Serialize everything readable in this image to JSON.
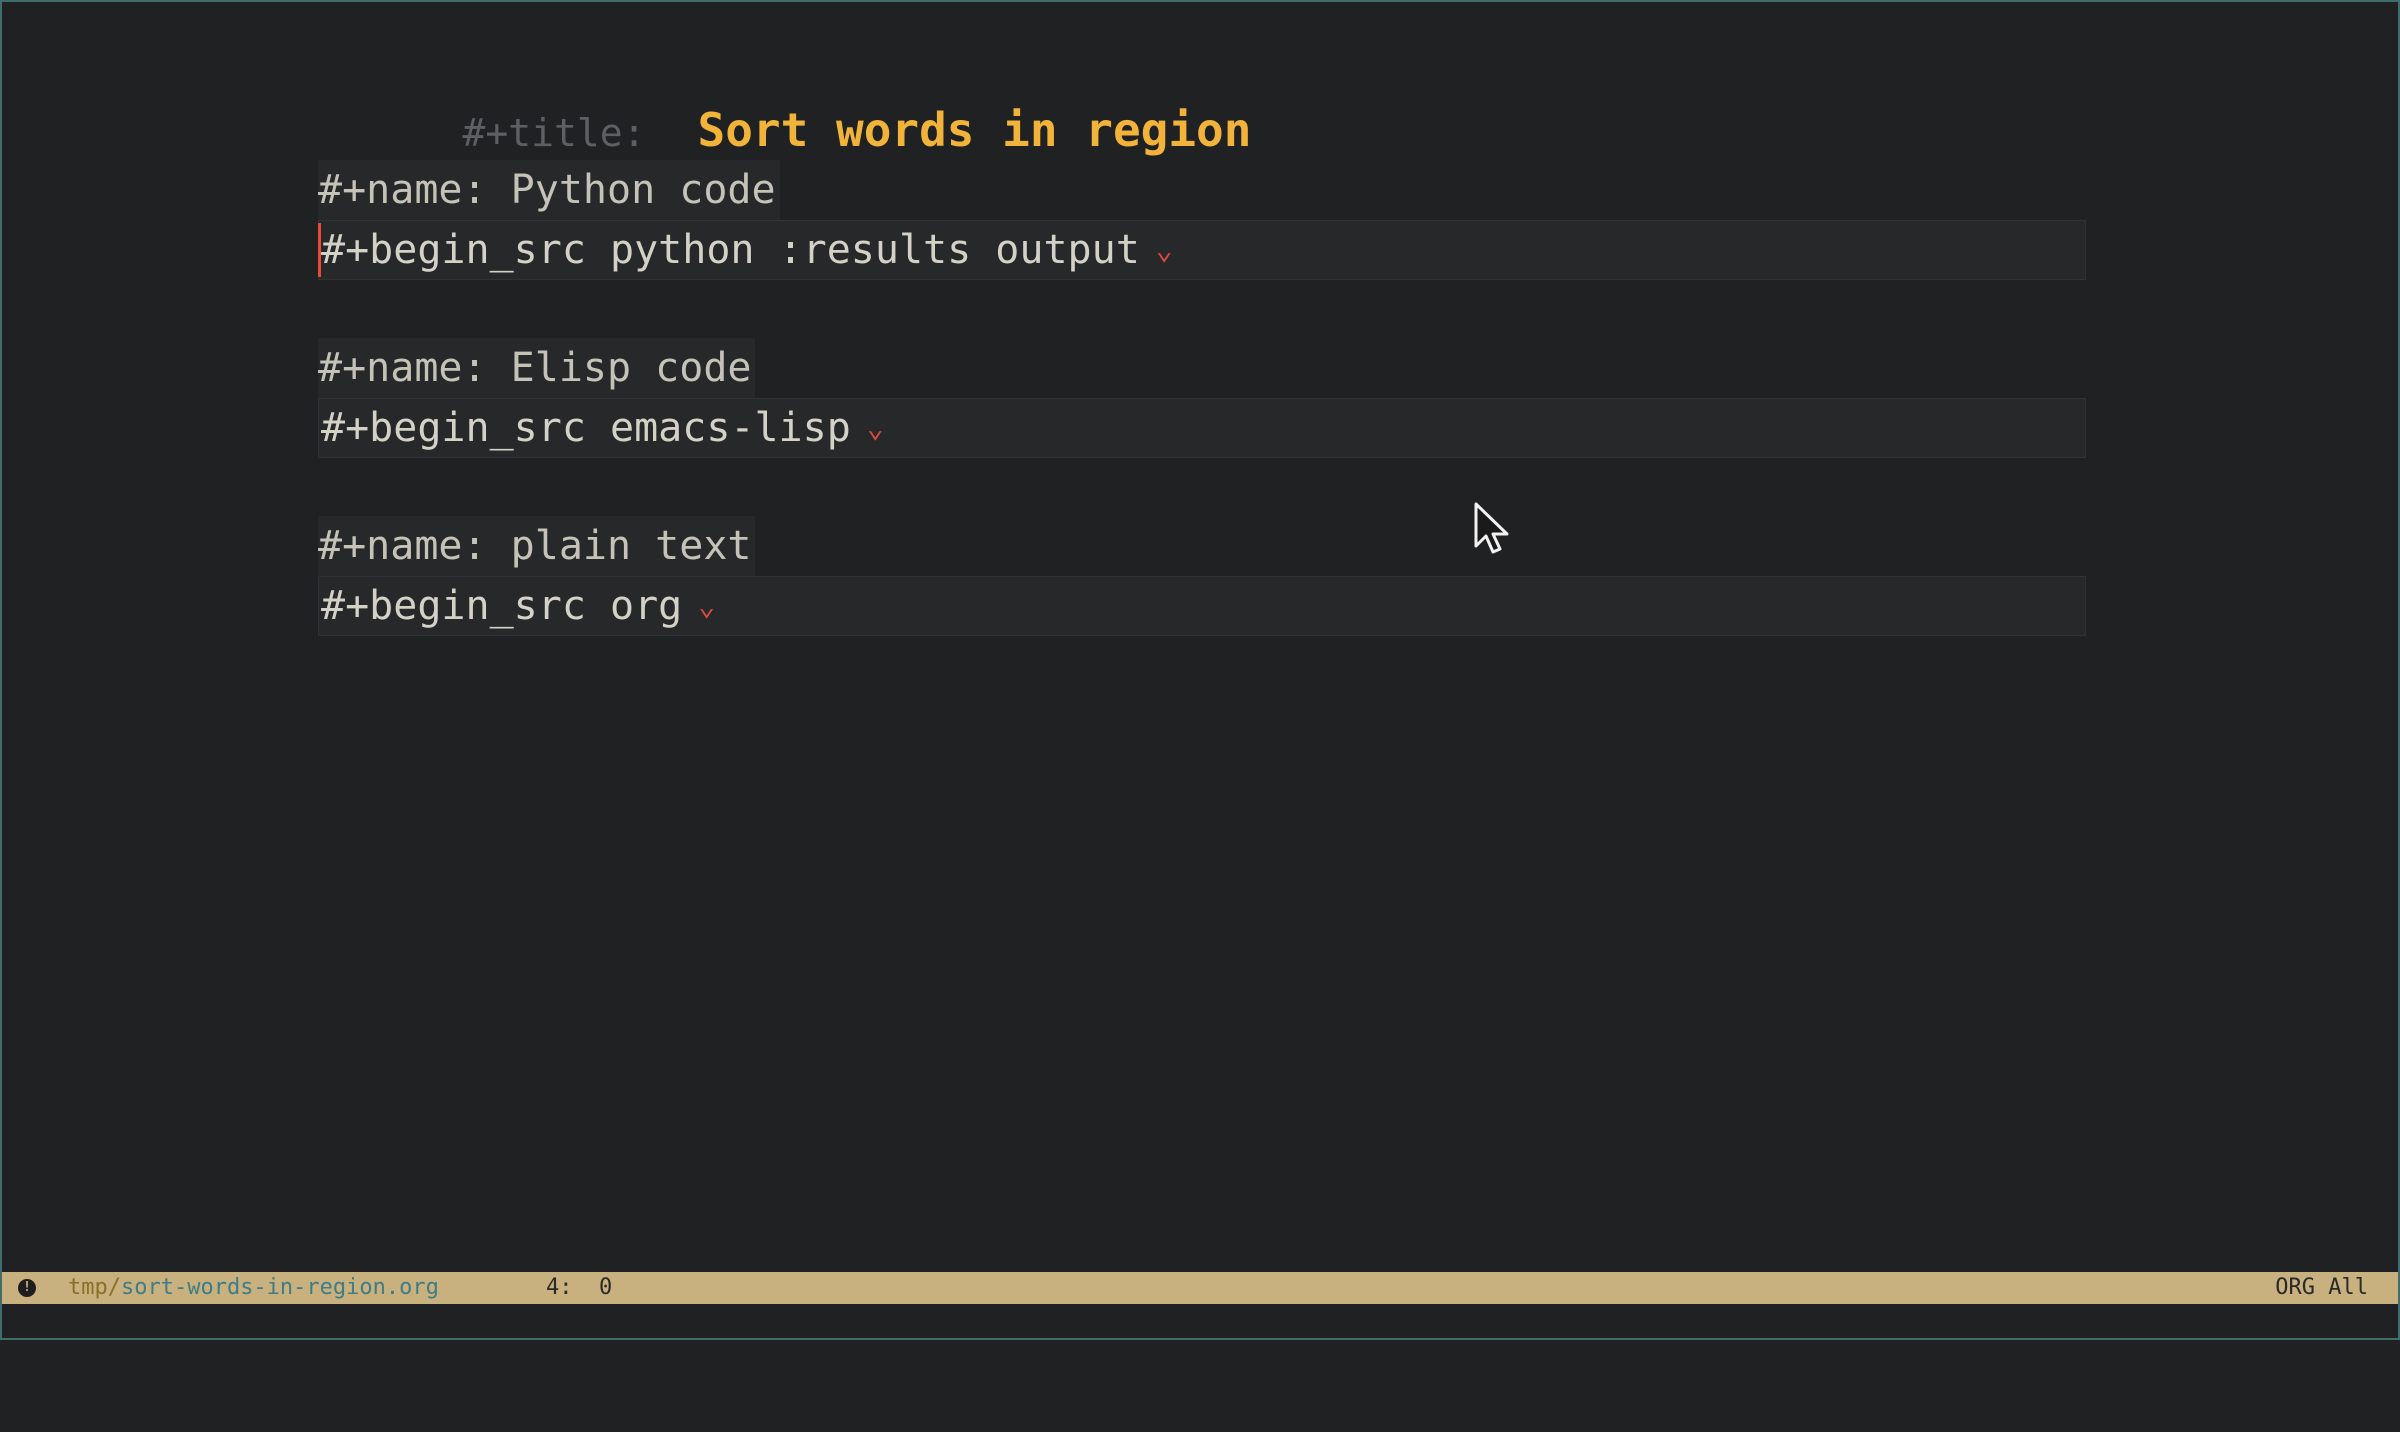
{
  "buffer": {
    "title_keyword": "#+title:",
    "title": "Sort words in region",
    "blocks": [
      {
        "name_line": "#+name: Python code",
        "begin_line": "#+begin_src python :results output"
      },
      {
        "name_line": "#+name: Elisp code",
        "begin_line": "#+begin_src emacs-lisp"
      },
      {
        "name_line": "#+name: plain text",
        "begin_line": "#+begin_src org"
      }
    ],
    "fold_glyph": "⌄"
  },
  "modeline": {
    "indicator": "!",
    "dir": "tmp/",
    "file": "sort-words-in-region.org",
    "position": "4:  0",
    "mode": "ORG All"
  },
  "colors": {
    "background": "#1f2123",
    "title": "#f2b33a",
    "modeline_bg": "#c8b17e",
    "fold_marker": "#e04a3c",
    "file_name": "#3f7c86"
  }
}
